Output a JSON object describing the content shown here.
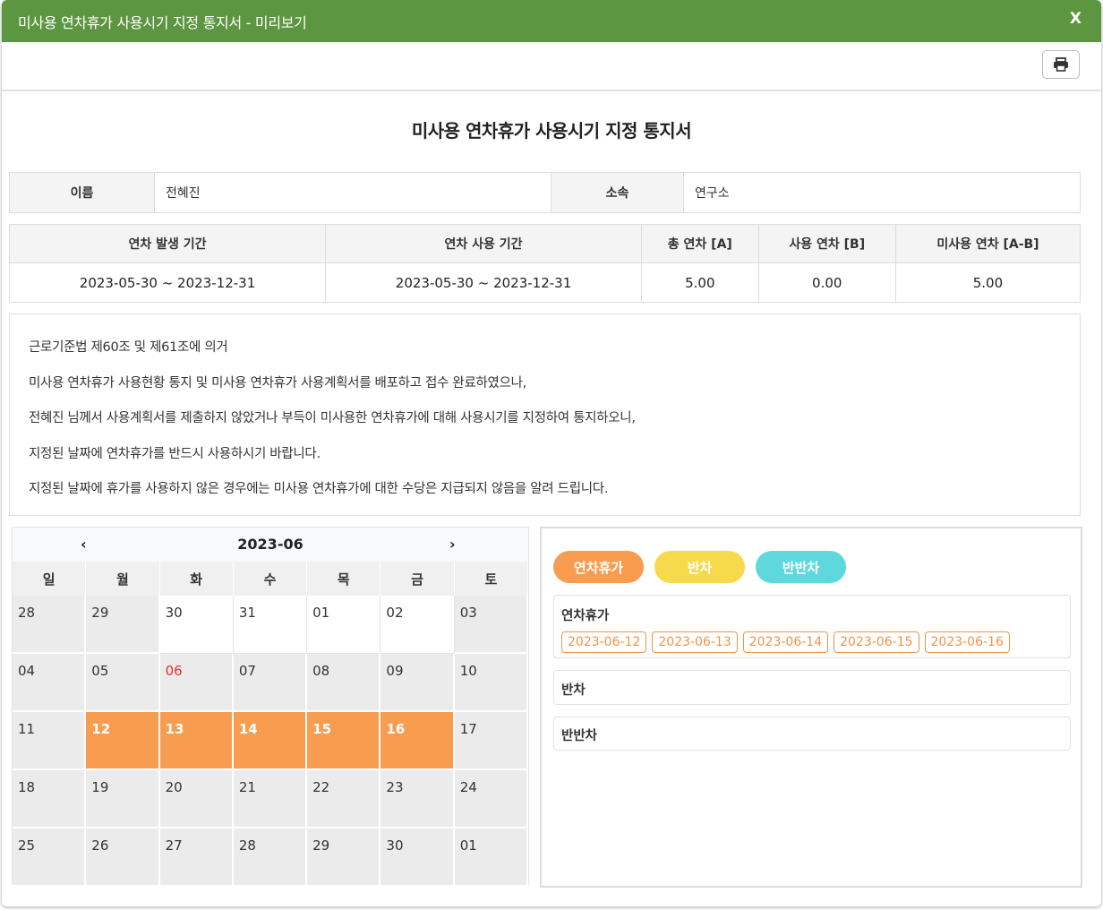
{
  "window": {
    "title": "미사용 연차휴가 사용시기 지정 통지서 - 미리보기",
    "close_label": "X"
  },
  "document": {
    "title": "미사용 연차휴가 사용시기 지정 통지서",
    "info": {
      "name_label": "이름",
      "name_value": "전혜진",
      "dept_label": "소속",
      "dept_value": "연구소"
    },
    "stats": {
      "headers": [
        "연차 발생 기간",
        "연차 사용 기간",
        "총 연차 [A]",
        "사용 연차 [B]",
        "미사용 연차 [A-B]"
      ],
      "values": [
        "2023-05-30 ~ 2023-12-31",
        "2023-05-30 ~ 2023-12-31",
        "5.00",
        "0.00",
        "5.00"
      ]
    },
    "notice_lines": [
      "근로기준법 제60조 및 제61조에 의거",
      "미사용 연차휴가 사용현황 통지 및 미사용 연차휴가 사용계획서를 배포하고 접수 완료하였으나,",
      "전혜진 님께서 사용계획서를 제출하지 않았거나 부득이 미사용한 연차휴가에 대해 사용시기를 지정하여 통지하오니,",
      "지정된 날짜에 연차휴가를 반드시 사용하시기 바랍니다.",
      "지정된 날짜에 휴가를 사용하지 않은 경우에는 미사용 연차휴가에 대한 수당은 지급되지 않음을 알려 드립니다."
    ]
  },
  "calendar": {
    "month": "2023-06",
    "prev": "‹",
    "next": "›",
    "weekdays": [
      "일",
      "월",
      "화",
      "수",
      "목",
      "금",
      "토"
    ],
    "days": [
      "28",
      "29",
      "30",
      "31",
      "01",
      "02",
      "03",
      "04",
      "05",
      "06",
      "07",
      "08",
      "09",
      "10",
      "11",
      "12",
      "13",
      "14",
      "15",
      "16",
      "17",
      "18",
      "19",
      "20",
      "21",
      "22",
      "23",
      "24",
      "25",
      "26",
      "27",
      "28",
      "29",
      "30",
      "01"
    ],
    "white_days": [
      2,
      3,
      4,
      5
    ],
    "selected_days": [
      15,
      16,
      17,
      18,
      19
    ],
    "holiday_days": [
      9
    ],
    "colors": {
      "selected": "#f89d50",
      "holiday": "#e8302f"
    }
  },
  "legend": [
    {
      "label": "연차휴가",
      "color": "#f89d50"
    },
    {
      "label": "반차",
      "color": "#f7d94c"
    },
    {
      "label": "반반차",
      "color": "#5ed8dd"
    }
  ],
  "leave_lists": {
    "annual_title": "연차휴가",
    "annual_dates": [
      "2023-06-12",
      "2023-06-13",
      "2023-06-14",
      "2023-06-15",
      "2023-06-16"
    ],
    "half_title": "반차",
    "quarter_title": "반반차"
  }
}
